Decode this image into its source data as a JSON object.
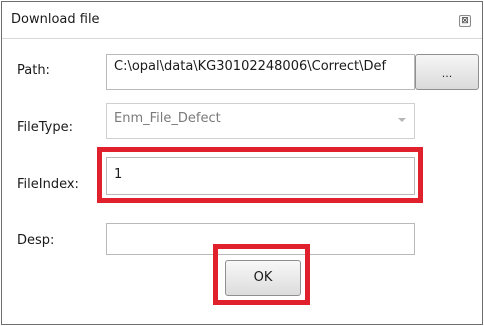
{
  "window": {
    "title": "Download file",
    "close_glyph": "⊠"
  },
  "form": {
    "path_label": "Path:",
    "path_value": "C:\\opal\\data\\KG30102248006\\Correct\\Def",
    "browse_label": "...",
    "filetype_label": "FileType:",
    "filetype_value": "Enm_File_Defect",
    "fileindex_label": "FileIndex:",
    "fileindex_value": "1",
    "desp_label": "Desp:",
    "desp_value": "",
    "ok_label": "OK"
  },
  "highlight_color": "#e0202c"
}
